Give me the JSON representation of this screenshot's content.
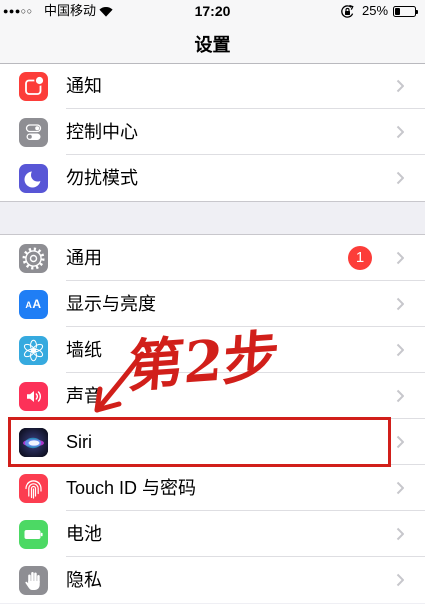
{
  "status_bar": {
    "signal": "●●●○○",
    "carrier": "中国移动",
    "time": "17:20",
    "battery_text": "25%",
    "battery_level": 0.25,
    "icons": [
      "wifi-icon",
      "rotation-lock-icon",
      "status-battery-icon"
    ]
  },
  "nav": {
    "title": "设置"
  },
  "groups": [
    {
      "items": [
        {
          "label": "通知",
          "icon": "notifications-icon",
          "icon_color": "#fc3d39"
        },
        {
          "label": "控制中心",
          "icon": "control-center-icon",
          "icon_color": "#8e8e93"
        },
        {
          "label": "勿扰模式",
          "icon": "moon-icon",
          "icon_color": "#5856d6"
        }
      ]
    },
    {
      "items": [
        {
          "label": "通用",
          "icon": "gear-icon",
          "icon_color": "#8e8e93",
          "badge": "1"
        },
        {
          "label": "显示与亮度",
          "icon": "display-brightness-icon",
          "icon_color": "#1f7ef5",
          "icon_text": "AA"
        },
        {
          "label": "墙纸",
          "icon": "wallpaper-flower-icon",
          "icon_color": "#36aadf"
        },
        {
          "label": "声音",
          "icon": "speaker-icon",
          "icon_color": "#fc3158"
        },
        {
          "label": "Siri",
          "icon": "siri-icon",
          "icon_color": "#16182b",
          "highlighted": true
        },
        {
          "label": "Touch ID 与密码",
          "icon": "fingerprint-icon",
          "icon_color": "#fc3d50"
        },
        {
          "label": "电池",
          "icon": "battery-icon",
          "icon_color": "#4cd964"
        },
        {
          "label": "隐私",
          "icon": "hand-icon",
          "icon_color": "#8e8e93"
        }
      ]
    }
  ],
  "annotation": {
    "text": "第2步",
    "color": "#d11f1a"
  },
  "colors": {
    "badge": "#fc3d39",
    "chevron": "#c7c7cc",
    "background": "#efeff4",
    "nav_background": "#f7f7f8"
  }
}
